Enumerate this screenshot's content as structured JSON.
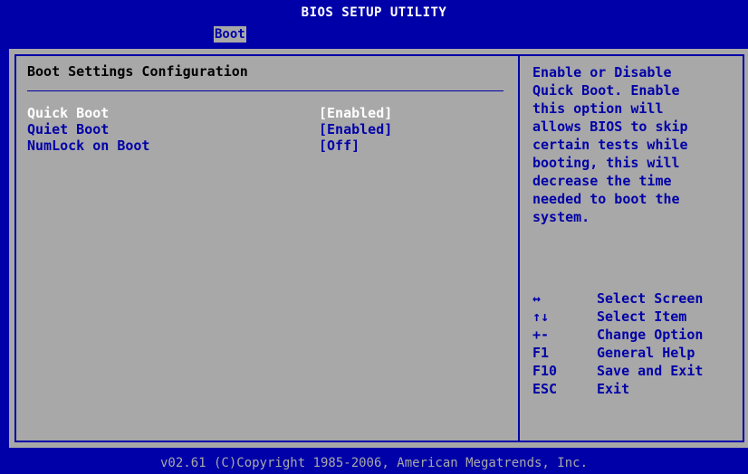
{
  "title": "BIOS SETUP UTILITY",
  "menu": {
    "tabs": [
      {
        "label": "Boot",
        "selected": true
      }
    ]
  },
  "main": {
    "section_title": "Boot Settings Configuration",
    "settings": [
      {
        "label": "Quick Boot",
        "value": "[Enabled]",
        "selected": true
      },
      {
        "label": "Quiet Boot",
        "value": "[Enabled]",
        "selected": false
      },
      {
        "label": "NumLock on Boot",
        "value": "[Off]",
        "selected": false
      }
    ]
  },
  "help": {
    "text": "Enable or Disable\nQuick Boot. Enable\nthis option will\nallows BIOS to skip\ncertain tests while\nbooting, this will\ndecrease the time\nneeded to boot the\nsystem."
  },
  "keys": [
    {
      "key": "↔",
      "desc": "Select Screen"
    },
    {
      "key": "↑↓",
      "desc": "Select Item"
    },
    {
      "key": "+-",
      "desc": "Change Option"
    },
    {
      "key": "F1",
      "desc": "General Help"
    },
    {
      "key": "F10",
      "desc": "Save and Exit"
    },
    {
      "key": "ESC",
      "desc": "Exit"
    }
  ],
  "footer": "v02.61 (C)Copyright 1985-2006, American Megatrends, Inc.",
  "colors": {
    "background": "#0000a8",
    "panel": "#a8a8a8",
    "highlight": "#ffffff",
    "text": "#0000a8"
  }
}
